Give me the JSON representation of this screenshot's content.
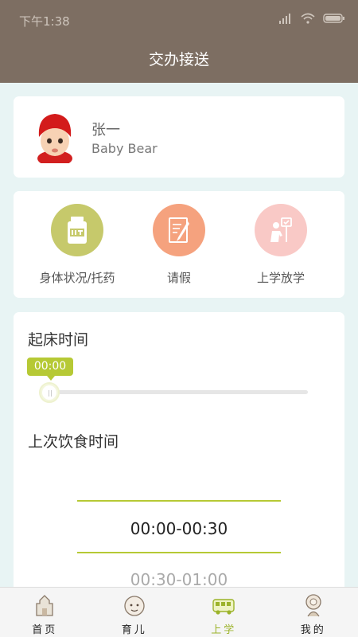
{
  "status_bar": {
    "time": "下午1:38"
  },
  "header": {
    "title": "交办接送"
  },
  "profile": {
    "name": "张一",
    "subtitle": "Baby Bear"
  },
  "actions": [
    {
      "label": "身体状况/托药",
      "icon": "medicine-bottle-icon",
      "color": "#c6c96b"
    },
    {
      "label": "请假",
      "icon": "leave-note-icon",
      "color": "#f5a27e"
    },
    {
      "label": "上学放学",
      "icon": "school-pickup-icon",
      "color": "#f9c9c6"
    }
  ],
  "wake_time": {
    "title": "起床时间",
    "value": "00:00",
    "level": 0
  },
  "last_meal": {
    "title": "上次饮食时间",
    "selected": "00:00-00:30",
    "next": "00:30-01:00"
  },
  "tabbar": {
    "items": [
      {
        "label": "首页",
        "icon": "home-castle-icon"
      },
      {
        "label": "育儿",
        "icon": "baby-face-icon"
      },
      {
        "label": "上学",
        "icon": "school-bus-icon",
        "active": true
      },
      {
        "label": "我的",
        "icon": "flower-person-icon"
      }
    ]
  },
  "colors": {
    "header": "#7d6e62",
    "accent": "#b6c935",
    "background": "#e8f4f4"
  }
}
